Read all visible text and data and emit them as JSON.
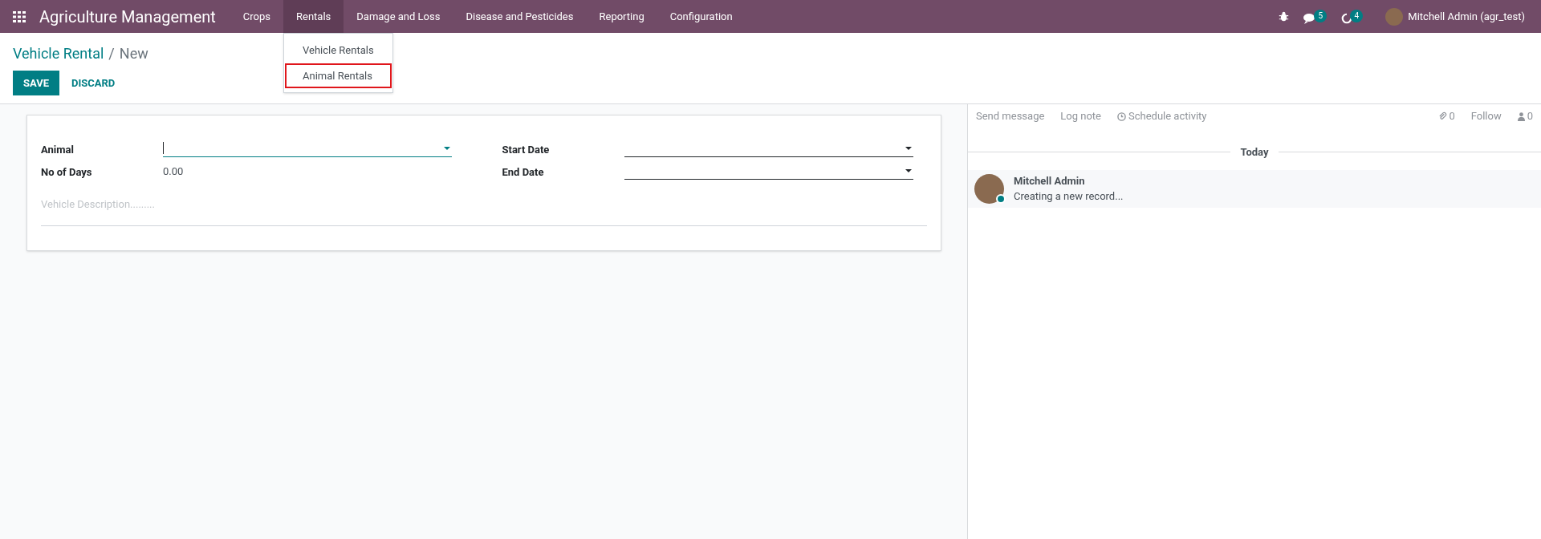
{
  "navbar": {
    "brand": "Agriculture Management",
    "menus": [
      {
        "label": "Crops",
        "selected": false
      },
      {
        "label": "Rentals",
        "selected": true
      },
      {
        "label": "Damage and Loss",
        "selected": false
      },
      {
        "label": "Disease and Pesticides",
        "selected": false
      },
      {
        "label": "Reporting",
        "selected": false
      },
      {
        "label": "Configuration",
        "selected": false
      }
    ],
    "dropdown": [
      {
        "label": "Vehicle Rentals",
        "highlighted": false
      },
      {
        "label": "Animal Rentals",
        "highlighted": true
      }
    ],
    "messages_badge": "5",
    "activities_badge": "4",
    "user": "Mitchell Admin (agr_test)"
  },
  "breadcrumb": {
    "parent": "Vehicle Rental",
    "separator": "/",
    "current": "New"
  },
  "buttons": [
    {
      "label": "SAVE",
      "kind": "primary"
    },
    {
      "label": "DISCARD",
      "kind": "link"
    }
  ],
  "form": {
    "left_fields": [
      {
        "label": "Animal",
        "kind": "many2one",
        "focused": true
      },
      {
        "label": "No of Days",
        "kind": "number",
        "value": "0.00",
        "focused": false
      }
    ],
    "right_fields": [
      {
        "label": "Start Date",
        "kind": "date",
        "focused": false
      },
      {
        "label": "End Date",
        "kind": "date",
        "focused": false
      }
    ],
    "description": {
      "placeholder": "Vehicle Description........."
    }
  },
  "chatter": {
    "actions": [
      "Send message",
      "Log note",
      "Schedule activity"
    ],
    "attachments": "0",
    "follow": "Follow",
    "followers": "0",
    "date_separator": "Today",
    "messages": [
      {
        "author": "Mitchell Admin",
        "body": "Creating a new record...",
        "online": true
      }
    ]
  }
}
